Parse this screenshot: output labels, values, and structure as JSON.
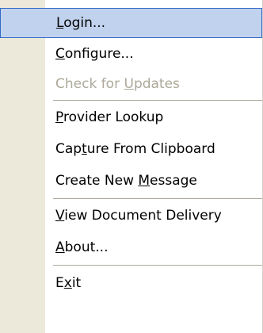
{
  "menu": {
    "items": [
      {
        "pre": "",
        "key": "L",
        "post": "ogin..."
      },
      {
        "pre": "",
        "key": "C",
        "post": "onfigure..."
      },
      {
        "pre": "Check for ",
        "key": "U",
        "post": "pdates"
      },
      {
        "pre": "",
        "key": "P",
        "post": "rovider Lookup"
      },
      {
        "pre": "Cap",
        "key": "t",
        "post": "ure From Clipboard"
      },
      {
        "pre": "Create New ",
        "key": "M",
        "post": "essage"
      },
      {
        "pre": "",
        "key": "V",
        "post": "iew Document Delivery"
      },
      {
        "pre": "",
        "key": "A",
        "post": "bout..."
      },
      {
        "pre": "E",
        "key": "x",
        "post": "it"
      }
    ]
  },
  "colors": {
    "highlight_fill": "#c1d2ee",
    "highlight_border": "#316ac5",
    "gutter": "#ede9da",
    "disabled_text": "#aca899"
  }
}
